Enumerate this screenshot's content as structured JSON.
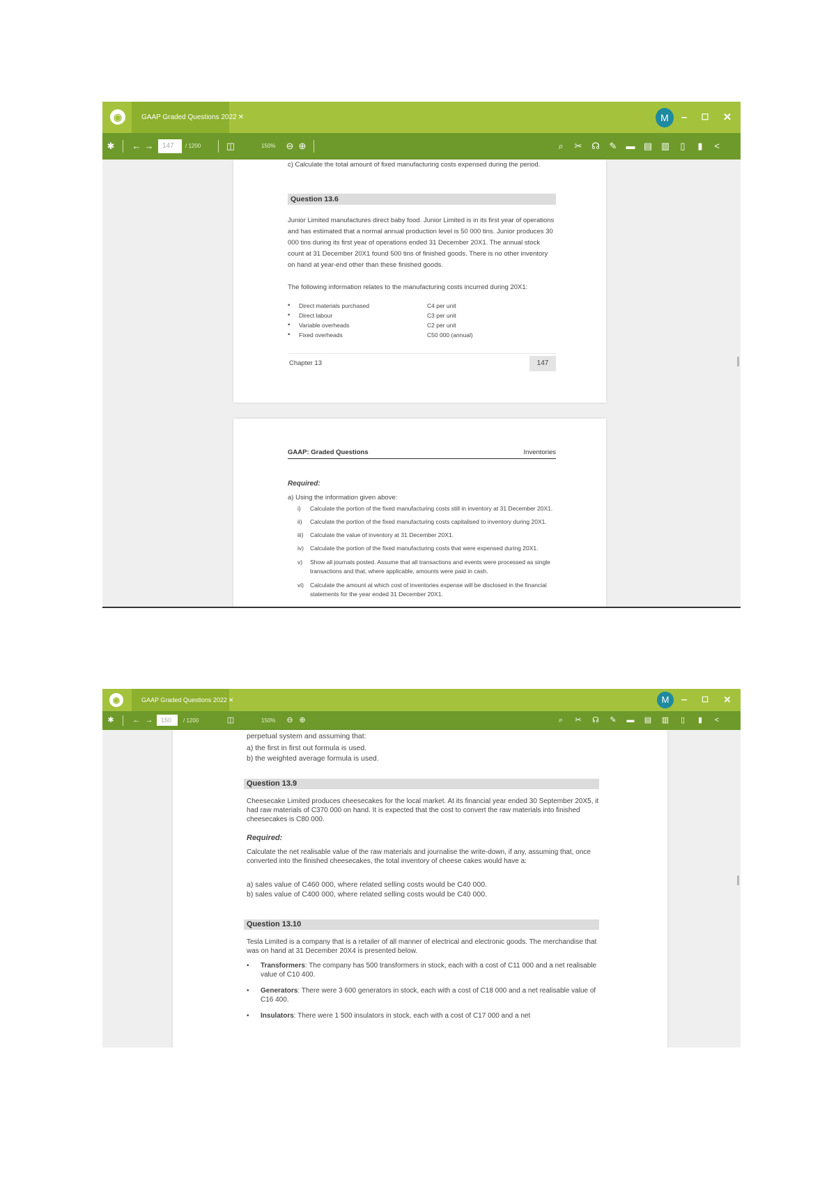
{
  "window1": {
    "tab_title": "GAAP Graded Questions 2022",
    "avatar": "M",
    "page_number": "147",
    "zoom": "150%",
    "doc": {
      "line_c": "c) Calculate the total amount of fixed manufacturing costs expensed during the period.",
      "q_heading": "Question 13.6",
      "para1": "Junior Limited manufactures direct baby food. Junior Limited is in its first year of operations and has estimated that a normal annual production level is 50 000 tins. Junior produces 30 000 tins during its first year of operations ended 31 December 20X1. The annual stock count at 31 December 20X1 found 500 tins of finished goods. There is no other inventory on hand at year-end other than these finished goods.",
      "para2": "The following information relates to the manufacturing costs incurred during 20X1:",
      "costs": [
        {
          "label": "Direct materials purchased",
          "value": "C4 per unit"
        },
        {
          "label": "Direct labour",
          "value": "C3 per unit"
        },
        {
          "label": "Variable overheads",
          "value": "C2 per unit"
        },
        {
          "label": "Fixed overheads",
          "value": "C50 000 (annual)"
        }
      ],
      "footer_left": "Chapter 13",
      "footer_right": "147",
      "header2_left": "GAAP: Graded Questions",
      "header2_right": "Inventories",
      "required": "Required:",
      "req_a": "a) Using the information given above:",
      "req_items": [
        {
          "num": "i)",
          "text": "Calculate the portion of the fixed manufacturing costs still in inventory at 31 December 20X1."
        },
        {
          "num": "ii)",
          "text": "Calculate the portion of the fixed manufacturing costs capitalised to inventory during 20X1."
        },
        {
          "num": "iii)",
          "text": "Calculate the value of inventory at 31 December 20X1."
        },
        {
          "num": "iv)",
          "text": "Calculate the portion of the fixed manufacturing costs that were expensed during 20X1."
        },
        {
          "num": "v)",
          "text": "Show all journals posted. Assume that all transactions and events were processed as single transactions and that, where applicable, amounts were paid in cash."
        },
        {
          "num": "vi)",
          "text": "Calculate the amount at which cost of inventories expense will be disclosed in the financial statements for the year ended 31 December 20X1."
        }
      ]
    }
  },
  "window2": {
    "tab_title": "GAAP Graded Questions 2022",
    "avatar": "M",
    "page_number": "150",
    "zoom": "150%",
    "doc": {
      "top_line": "perpetual system and assuming that:",
      "opt_a": "a) the first in first out formula is used.",
      "opt_b": "b) the weighted average formula is used.",
      "q1_heading": "Question 13.9",
      "q1_para": "Cheesecake Limited produces cheesecakes for the local market. At its financial year ended 30 September 20X5, it had raw materials of C370 000 on hand. It is expected that the cost to convert the raw materials into finished cheesecakes is C80 000.",
      "required": "Required:",
      "req_para": "Calculate the net realisable value of the raw materials and journalise the write-down, if any, assuming that, once converted into the finished cheesecakes, the total inventory of cheese cakes would have a:",
      "req_a": "a) sales value of C460 000, where related selling costs would be C40 000.",
      "req_b": "b) sales value of C400 000, where related selling costs would be C40 000.",
      "q2_heading": "Question 13.10",
      "q2_para": "Tesla Limited is a company that is a retailer of all manner of electrical and electronic goods. The merchandise that was on hand at 31 December 20X4 is presented below.",
      "bullets": [
        {
          "bold": "Transformers",
          "text": ": The company has 500 transformers in stock, each with a cost of C11 000 and a net realisable value of C10 400."
        },
        {
          "bold": "Generators",
          "text": ": There were 3 600 generators in stock, each with a cost of C18 000 and a net realisable value of C16 400."
        },
        {
          "bold": "Insulators",
          "text": ": There were 1 500 insulators in stock, each with a cost of C17 000 and a net"
        }
      ]
    }
  },
  "icons": [
    "settings-icon",
    "back-arrow-icon",
    "forward-arrow-icon",
    "sidebar-icon",
    "zoom-out-icon",
    "zoom-in-icon",
    "search-icon",
    "scissors-icon",
    "read-aloud-icon",
    "pen-icon",
    "comment-icon",
    "document-icon",
    "notes-icon",
    "bookmark-outline-icon",
    "bookmark-icon",
    "share-icon"
  ],
  "colors": {
    "titlebar": "#a4c23c",
    "toolbar": "#6e9a2b",
    "avatar": "#1e8aa0"
  }
}
